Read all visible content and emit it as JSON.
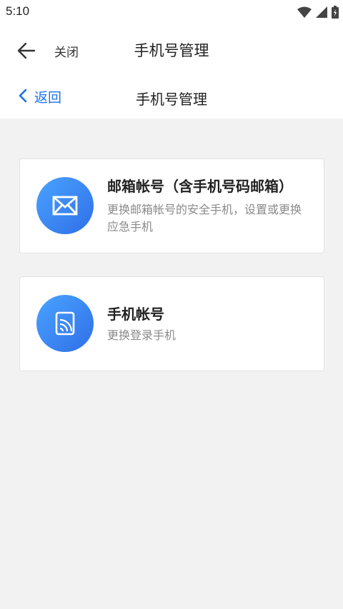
{
  "status_bar": {
    "time": "5:10",
    "icons": [
      "wifi-icon",
      "signal-icon",
      "battery-icon"
    ]
  },
  "top_bar": {
    "close_label": "关闭",
    "title": "手机号管理"
  },
  "sub_nav": {
    "back_label": "返回",
    "title": "手机号管理"
  },
  "cards": [
    {
      "title": "邮箱帐号（含手机号码邮箱）",
      "description": "更换邮箱帐号的安全手机，设置或更换应急手机",
      "icon": "mail-icon"
    },
    {
      "title": "手机帐号",
      "description": "更换登录手机",
      "icon": "phone-icon"
    }
  ],
  "colors": {
    "accent": "#1a73e8",
    "icon_gradient_start": "#4aa3ff",
    "icon_gradient_end": "#2f6fe8",
    "background": "#f2f2f2"
  }
}
